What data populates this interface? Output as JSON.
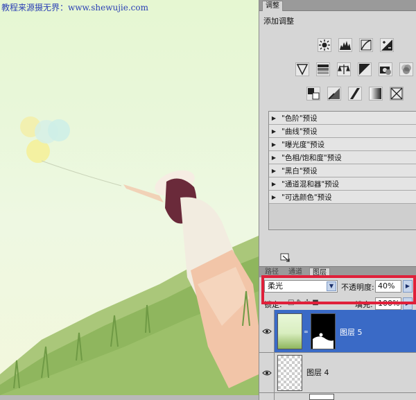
{
  "watermark": "教程来源摄无界：www.shewujie.com",
  "adjustments": {
    "tab_label": "调整",
    "add_label": "添加调整",
    "presets": [
      "\"色阶\"预设",
      "\"曲线\"预设",
      "\"曝光度\"预设",
      "\"色相/饱和度\"预设",
      "\"黑白\"预设",
      "\"通道混和器\"预设",
      "\"可选颜色\"预设"
    ]
  },
  "layers_panel": {
    "tabs": [
      "路径",
      "通道",
      "图层"
    ],
    "active_tab": "图层",
    "blend_mode": "柔光",
    "opacity_label": "不透明度:",
    "opacity_value": "40%",
    "lock_label": "锁定:",
    "fill_label": "填充:",
    "fill_value": "100%",
    "layers": [
      {
        "name": "图层 5",
        "selected": true,
        "has_mask": true
      },
      {
        "name": "图层 4",
        "selected": false,
        "has_mask": false
      }
    ]
  },
  "colors": {
    "selected_layer": "#3a6ac6",
    "highlight_box": "#e0203a",
    "watermark": "#2a3fb5"
  }
}
